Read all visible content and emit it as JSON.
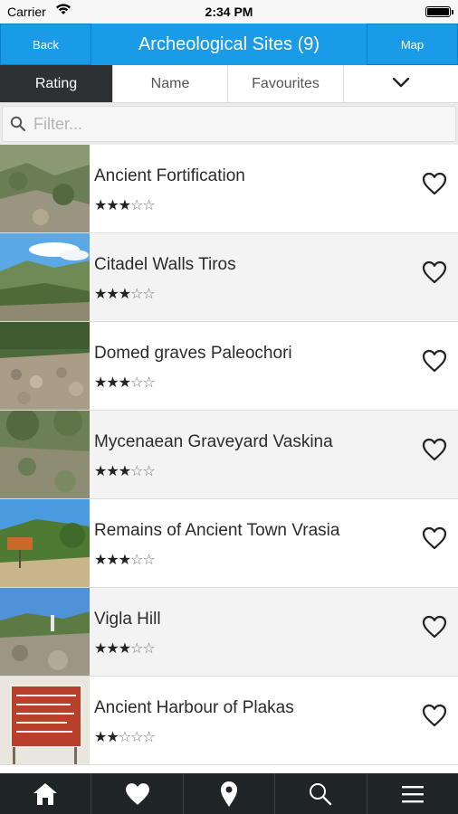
{
  "status_bar": {
    "carrier": "Carrier",
    "time": "2:34 PM"
  },
  "nav": {
    "back_label": "Back",
    "title": "Archeological Sites (9)",
    "map_label": "Map"
  },
  "sort_tabs": [
    {
      "label": "Rating",
      "active": true
    },
    {
      "label": "Name",
      "active": false
    },
    {
      "label": "Favourites",
      "active": false
    },
    {
      "label": "",
      "icon": "chevron-down-icon",
      "active": false
    }
  ],
  "filter": {
    "placeholder": "Filter...",
    "value": ""
  },
  "sites": [
    {
      "name": "Ancient Fortification",
      "rating": 3,
      "max_rating": 5,
      "favourite": false
    },
    {
      "name": "Citadel Walls Tiros",
      "rating": 3,
      "max_rating": 5,
      "favourite": false
    },
    {
      "name": "Domed graves Paleochori",
      "rating": 3,
      "max_rating": 5,
      "favourite": false
    },
    {
      "name": "Mycenaean Graveyard Vaskina",
      "rating": 3,
      "max_rating": 5,
      "favourite": false
    },
    {
      "name": "Remains of Ancient Town Vrasia",
      "rating": 3,
      "max_rating": 5,
      "favourite": false
    },
    {
      "name": "Vigla Hill",
      "rating": 3,
      "max_rating": 5,
      "favourite": false
    },
    {
      "name": "Ancient Harbour of Plakas",
      "rating": 2,
      "max_rating": 5,
      "favourite": false
    }
  ],
  "tab_bar": [
    {
      "icon": "home-icon"
    },
    {
      "icon": "heart-icon"
    },
    {
      "icon": "map-pin-icon"
    },
    {
      "icon": "search-icon"
    },
    {
      "icon": "menu-icon"
    }
  ],
  "colors": {
    "accent": "#1a9be8",
    "active_tab": "#2d3133",
    "tab_bar": "#1f2426"
  }
}
